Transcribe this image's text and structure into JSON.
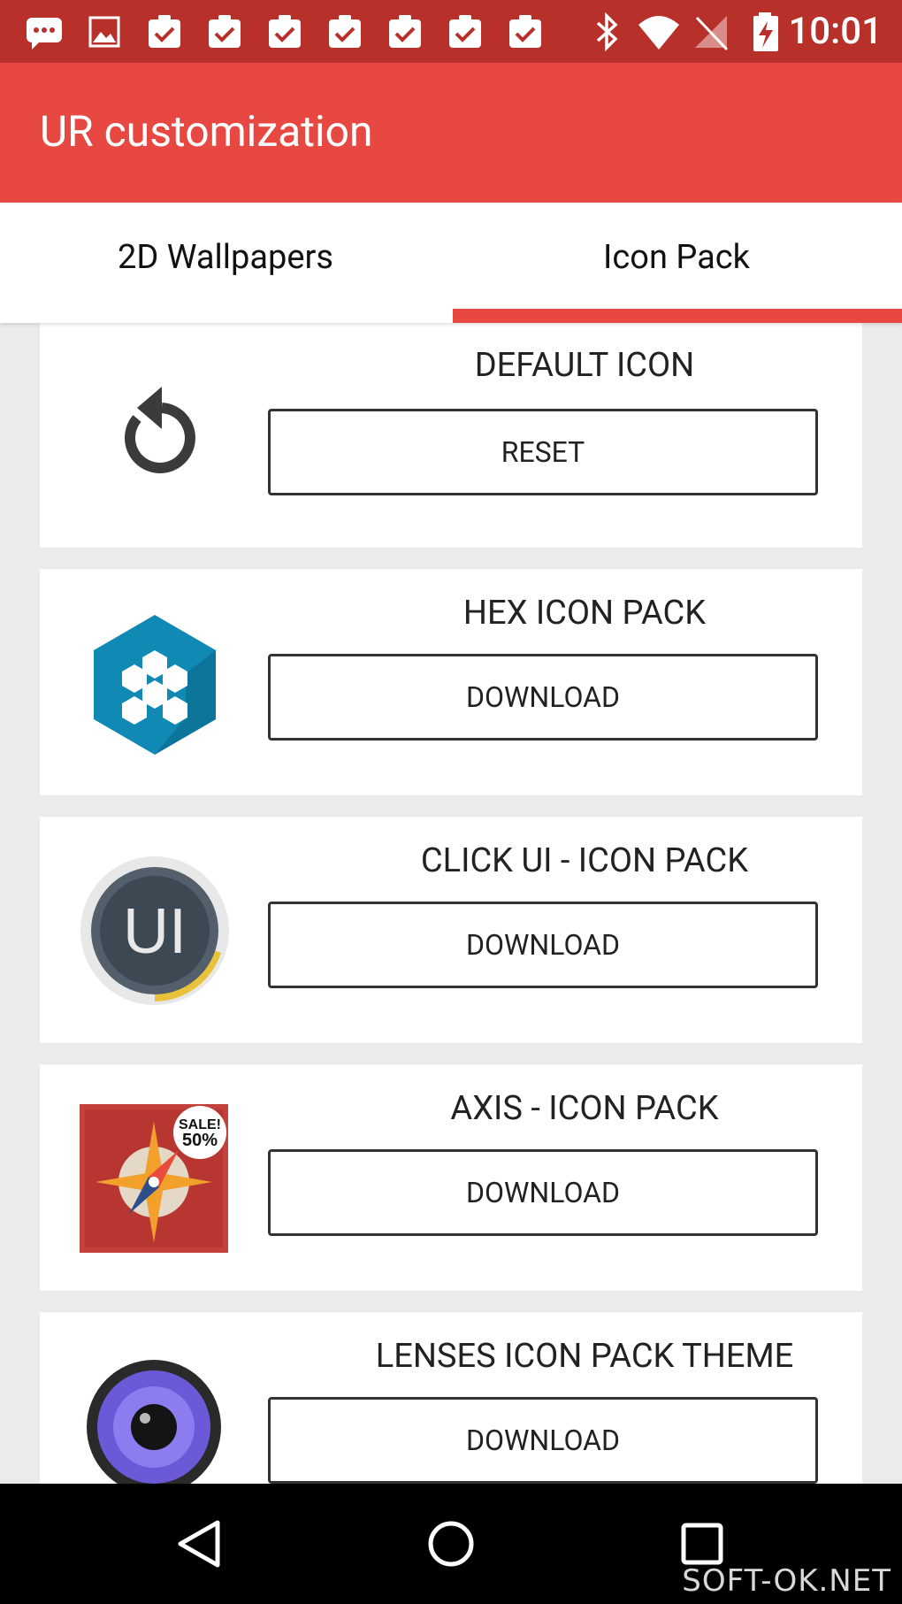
{
  "status_bar": {
    "time": "10:01",
    "notification_icons": [
      "chat-bubble-icon",
      "image-icon",
      "clipboard-check-icon",
      "clipboard-check-icon",
      "clipboard-check-icon",
      "clipboard-check-icon",
      "clipboard-check-icon",
      "clipboard-check-icon",
      "clipboard-check-icon"
    ],
    "system_icons": [
      "bluetooth-icon",
      "wifi-icon",
      "no-signal-icon",
      "battery-charging-icon"
    ]
  },
  "app_bar": {
    "title": "UR customization",
    "color": "#e74841"
  },
  "tabs": [
    {
      "label": "2D Wallpapers",
      "selected": false
    },
    {
      "label": "Icon Pack",
      "selected": true
    }
  ],
  "cards": [
    {
      "name": "DEFAULT ICON",
      "button": "RESET",
      "icon": "reset-icon"
    },
    {
      "name": "HEX ICON PACK",
      "button": "DOWNLOAD",
      "icon": "hex-icon-pack-logo"
    },
    {
      "name": "CLICK UI - ICON PACK",
      "button": "DOWNLOAD",
      "icon": "click-ui-logo",
      "logo_text": "UI"
    },
    {
      "name": "AXIS - ICON PACK",
      "button": "DOWNLOAD",
      "icon": "axis-compass-logo",
      "badge_line1": "SALE!",
      "badge_line2": "50%"
    },
    {
      "name": "LENSES ICON PACK THEME",
      "button": "DOWNLOAD",
      "icon": "lenses-eye-logo"
    }
  ],
  "nav_bar": {
    "buttons": [
      "back-icon",
      "home-icon",
      "recents-icon"
    ]
  },
  "watermark": "SOFT-OK.NET"
}
